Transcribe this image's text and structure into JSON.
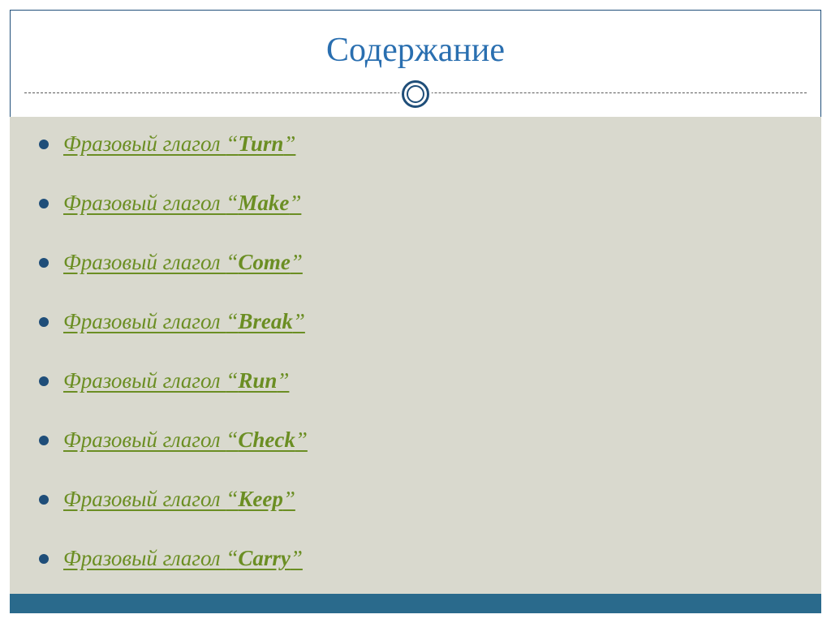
{
  "title": "Содержание",
  "list": {
    "prefix": "Фразовый глагол ",
    "lq": "“",
    "rq": "”",
    "items": [
      {
        "verb": "Turn"
      },
      {
        "verb": "Make"
      },
      {
        "verb": "Come"
      },
      {
        "verb": "Break"
      },
      {
        "verb": "Run"
      },
      {
        "verb": "Check"
      },
      {
        "verb": "Keep"
      },
      {
        "verb": "Carry"
      }
    ]
  },
  "colors": {
    "title": "#2a6fb0",
    "link": "#6b8e23",
    "bullet": "#1f4e79",
    "contentBg": "#d9d9ce",
    "bottomBand": "#2a6a8c"
  }
}
